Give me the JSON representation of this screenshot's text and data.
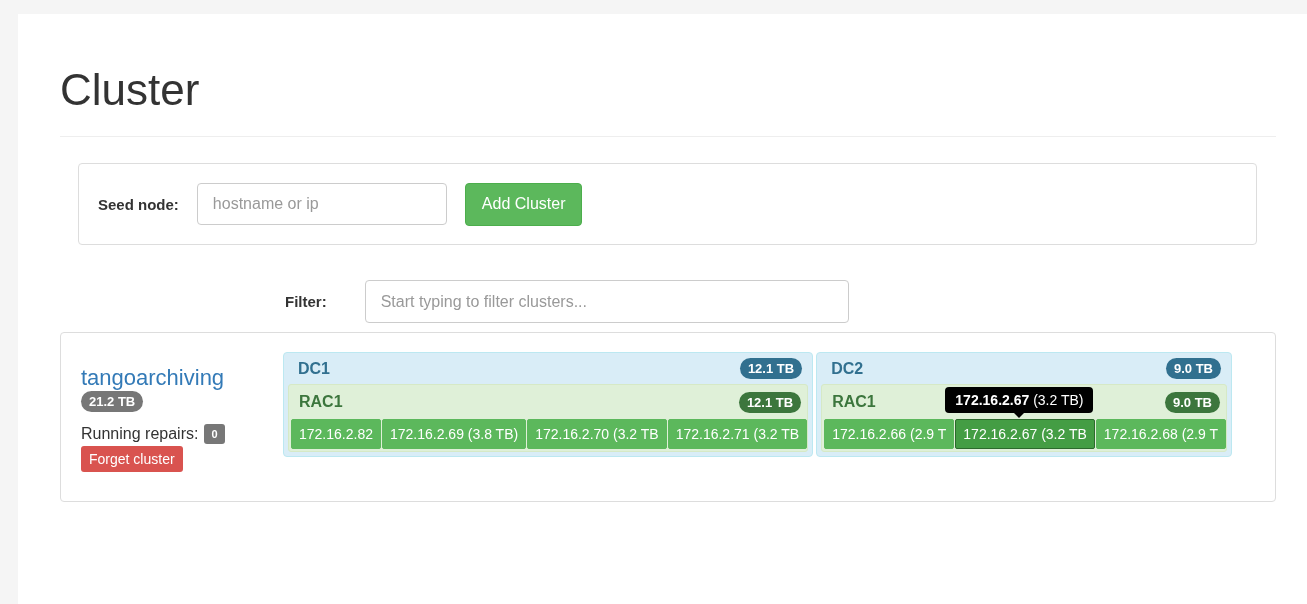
{
  "title": "Cluster",
  "seed_form": {
    "label": "Seed node:",
    "placeholder": "hostname or ip",
    "button": "Add Cluster"
  },
  "filter": {
    "label": "Filter:",
    "placeholder": "Start typing to filter clusters..."
  },
  "clusters": [
    {
      "name": "tangoarchiving",
      "size": "21.2 TB",
      "repairs_label": "Running repairs:",
      "repairs": "0",
      "forget_button": "Forget cluster",
      "datacenters": [
        {
          "name": "DC1",
          "size": "12.1 TB",
          "racks": [
            {
              "name": "RAC1",
              "size": "12.1 TB",
              "nodes": [
                {
                  "label": "172.16.2.82",
                  "hovered": false
                },
                {
                  "label": "172.16.2.69 (3.8 TB)",
                  "hovered": false
                },
                {
                  "label": "172.16.2.70 (3.2 TB",
                  "hovered": false
                },
                {
                  "label": "172.16.2.71 (3.2 TB",
                  "hovered": false
                }
              ]
            }
          ]
        },
        {
          "name": "DC2",
          "size": "9.0 TB",
          "racks": [
            {
              "name": "RAC1",
              "size": "9.0 TB",
              "nodes": [
                {
                  "label": "172.16.2.66 (2.9 T",
                  "hovered": false
                },
                {
                  "label": "172.16.2.67 (3.2 TB",
                  "hovered": true,
                  "tooltip": "**172.16.2.67** (3.2 TB)"
                },
                {
                  "label": "172.16.2.68 (2.9 T",
                  "hovered": false
                }
              ]
            }
          ]
        }
      ]
    }
  ]
}
